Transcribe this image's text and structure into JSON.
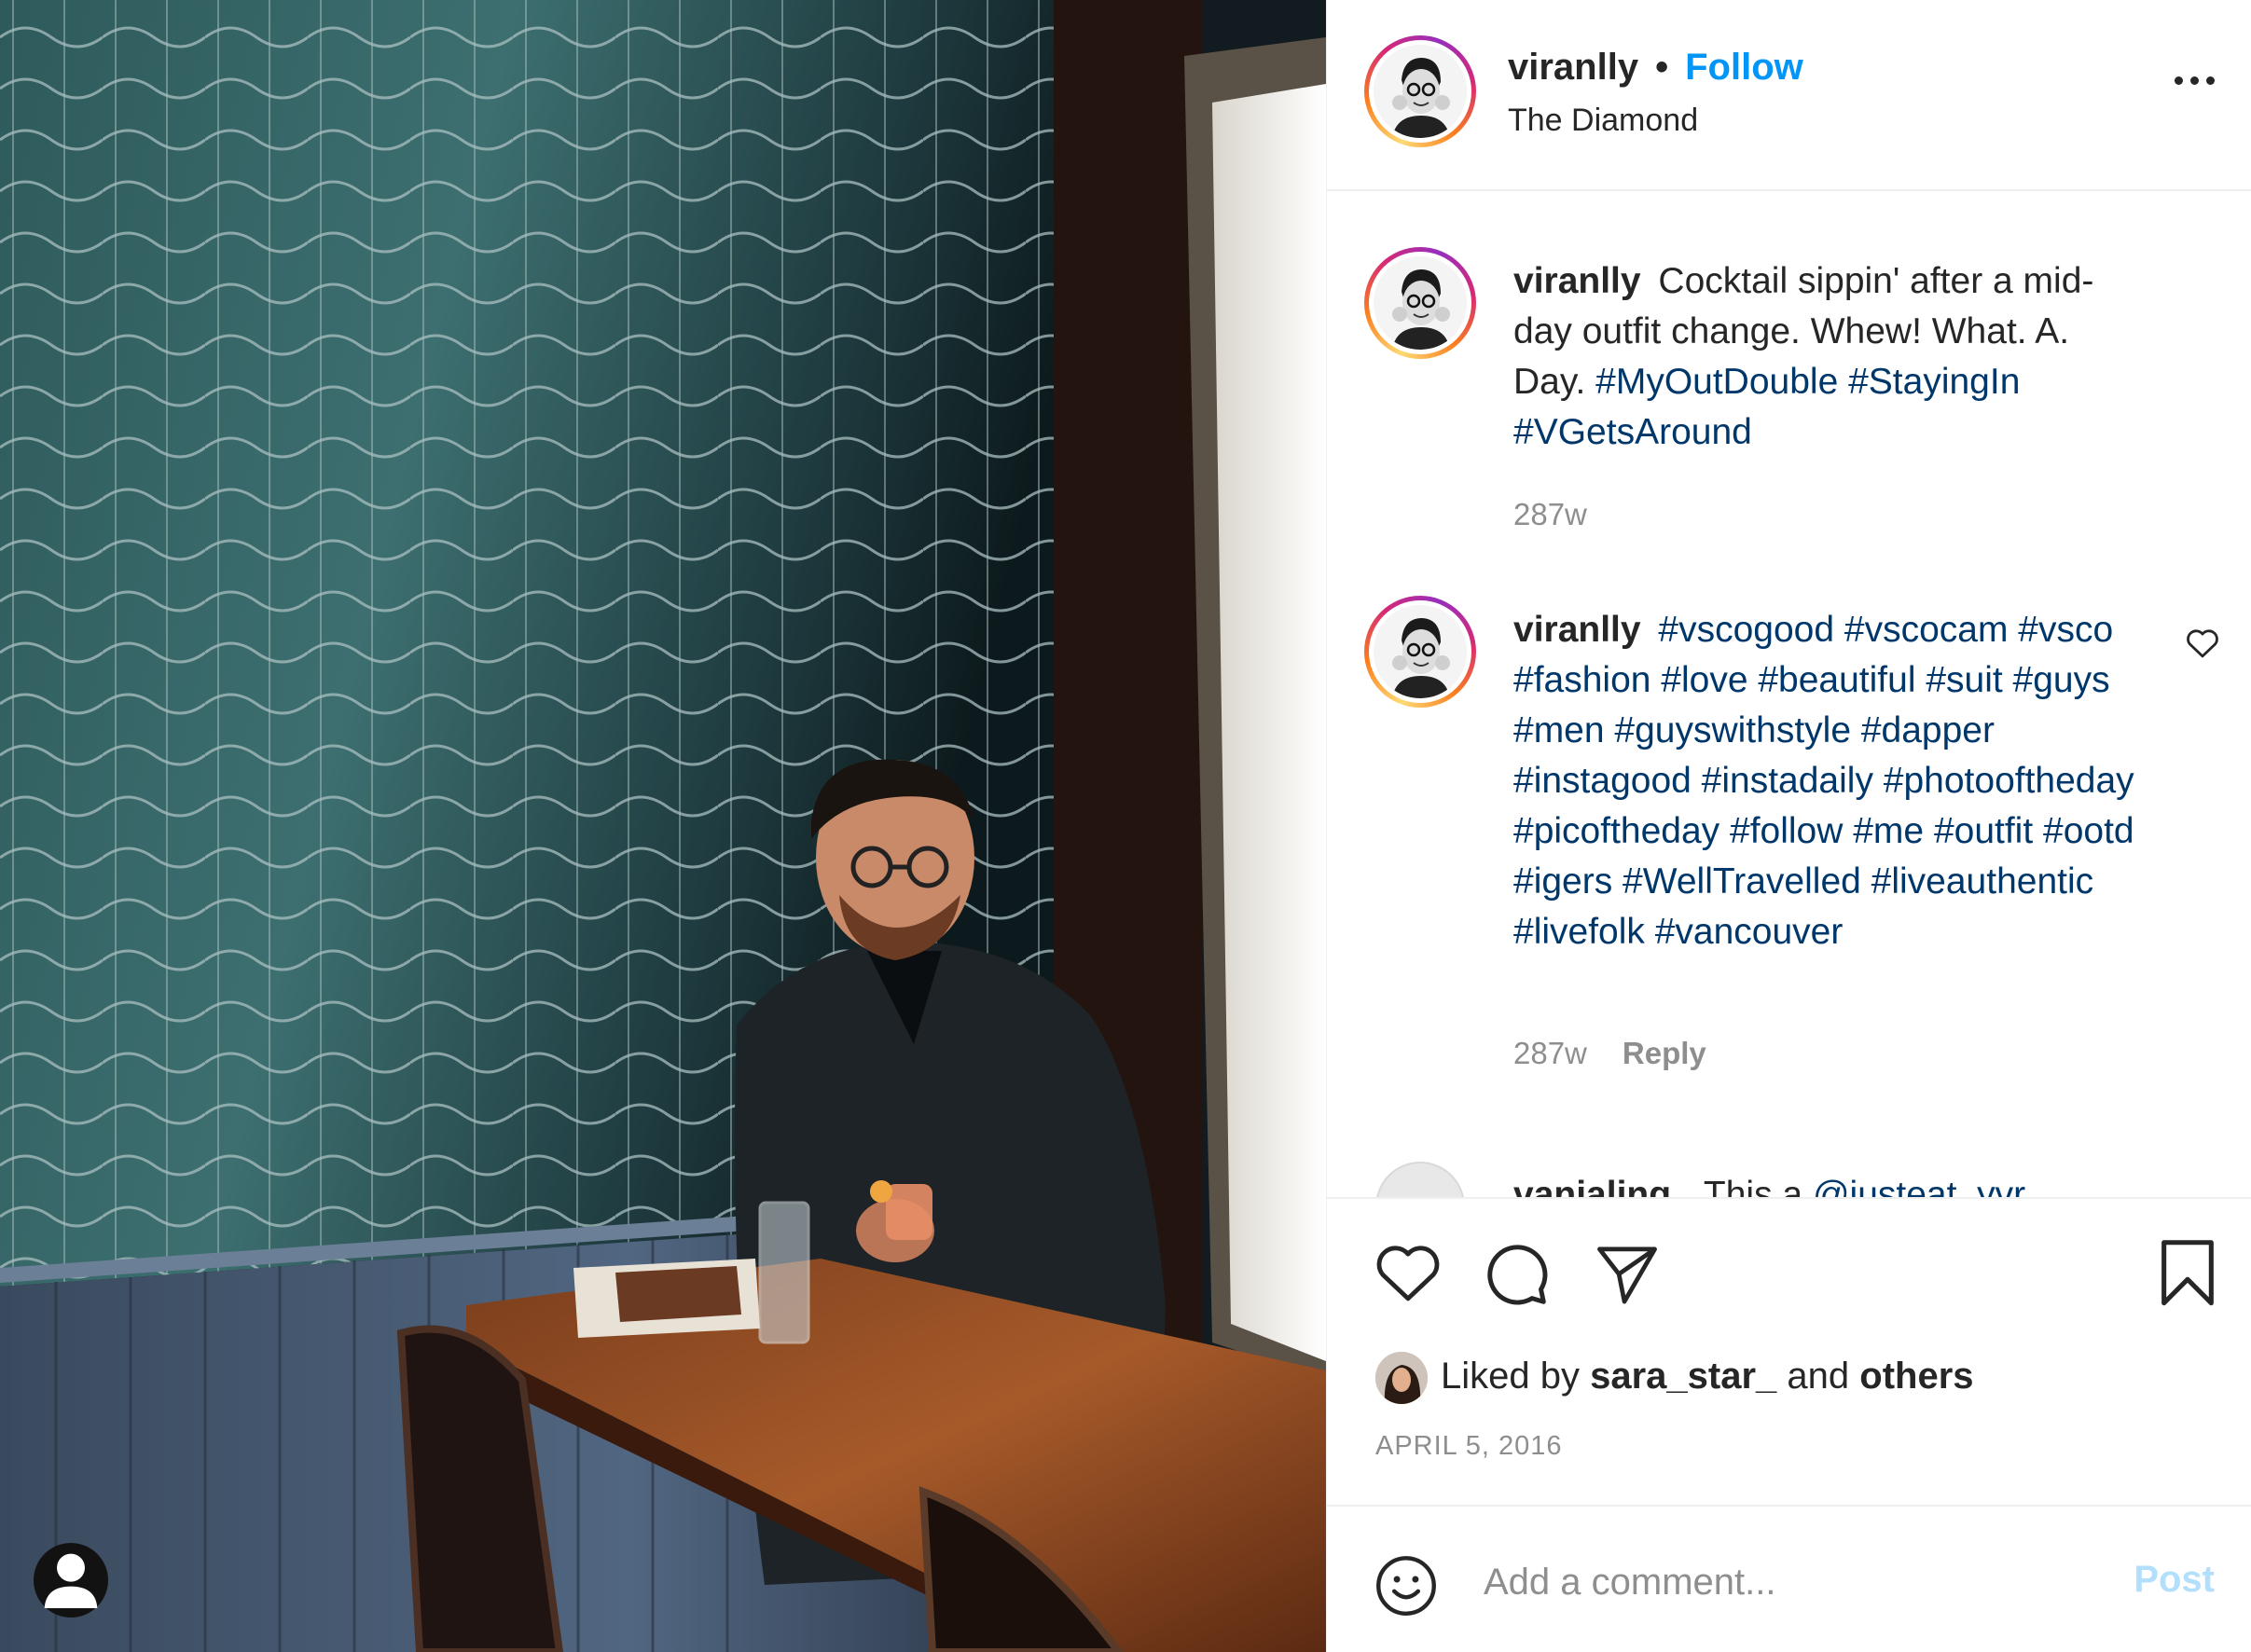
{
  "post": {
    "username": "viranlly",
    "follow_label": "Follow",
    "separator": "•",
    "location": "The Diamond"
  },
  "comments": [
    {
      "username": "viranlly",
      "text": "Cocktail sippin' after a mid-day outfit change. Whew! What. A. Day.",
      "hashtags": "#MyOutDouble #StayingIn #VGetsAround",
      "age": "287w"
    },
    {
      "username": "viranlly",
      "hashtags": "#vscogood #vscocam #vsco #fashion #love #beautiful #suit #guys #men #guyswithstyle #dapper #instagood #instadaily #photooftheday #picoftheday #follow #me #outfit #ootd #igers #WellTravelled #liveauthentic #livefolk #vancouver",
      "age": "287w",
      "reply_label": "Reply"
    }
  ],
  "partial_comment": {
    "username": "vanialing",
    "text": "This a",
    "mention": "@justeat_yvr"
  },
  "likes": {
    "prefix": "Liked by",
    "user": "sara_star_",
    "middle": "and",
    "suffix": "others"
  },
  "date": "APRIL 5, 2016",
  "add_comment": {
    "placeholder": "Add a comment...",
    "post_label": "Post"
  },
  "icons": {
    "more": "more-options-icon",
    "like": "heart-icon",
    "comment": "comment-bubble-icon",
    "share": "paper-plane-icon",
    "save": "bookmark-icon",
    "emoji": "smiley-icon",
    "tags": "user-tag-icon"
  },
  "colors": {
    "link_blue": "#0095f6",
    "hashtag_blue": "#00376b",
    "muted": "#8e8e8e",
    "post_disabled": "#b2dffc"
  }
}
